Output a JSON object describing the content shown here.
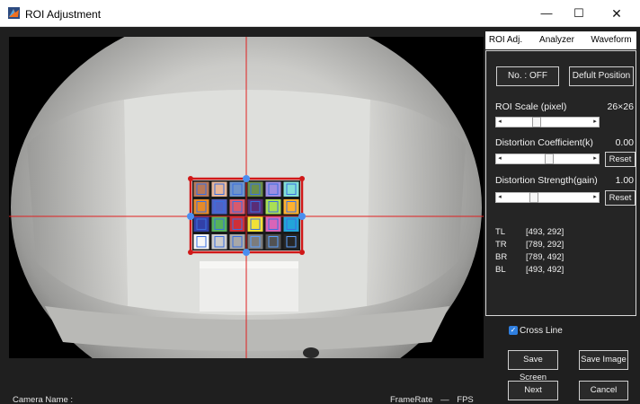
{
  "window": {
    "title": "ROI Adjustment",
    "minimize_glyph": "—",
    "maximize_glyph": "☐",
    "close_glyph": "✕"
  },
  "tabs": [
    {
      "label": "ROI Adj."
    },
    {
      "label": "Analyzer"
    },
    {
      "label": "Waveform"
    }
  ],
  "roi_panel": {
    "number_button": "No. : OFF",
    "default_position_button": "Defult Position",
    "roi_scale_label": "ROI Scale (pixel)",
    "roi_scale_value": "26×26",
    "distortion_coef_label": "Distortion Coefficient(k)",
    "distortion_coef_value": "0.00",
    "distortion_strength_label": "Distortion Strength(gain)",
    "distortion_strength_value": "1.00",
    "reset_label": "Reset",
    "sliders": {
      "roi_scale_fraction": 0.36,
      "distortion_coef_fraction": 0.52,
      "distortion_strength_fraction": 0.33
    },
    "corners": [
      {
        "name": "TL",
        "coords": "[493, 292]"
      },
      {
        "name": "TR",
        "coords": "[789, 292]"
      },
      {
        "name": "BR",
        "coords": "[789, 492]"
      },
      {
        "name": "BL",
        "coords": "[493, 492]"
      }
    ]
  },
  "controls": {
    "cross_line_label": "Cross Line",
    "cross_line_checked": true,
    "save_screen": "Save Screen",
    "save_image": "Save Image",
    "next": "Next",
    "cancel": "Cancel"
  },
  "status": {
    "camera_name_label": "Camera Name :",
    "framerate_label": "FrameRate",
    "framerate_value": "—",
    "fps_label": "FPS"
  },
  "colors": {
    "crosshair": "#e02020",
    "roi_box": "#d01818",
    "handle": "#4a8ef0",
    "checkbox": "#2f7fe0"
  },
  "icons": {
    "app": "matlab-icon",
    "slider_left": "arrow-left-icon",
    "slider_right": "arrow-right-icon"
  },
  "color_checker": [
    [
      "#b7785a",
      "#e8b79a",
      "#6f93c9",
      "#6b8f4c",
      "#9d8ee0",
      "#83e0d8"
    ],
    [
      "#e58a2a",
      "#4f63c7",
      "#d85a6e",
      "#5a2c77",
      "#a9df55",
      "#ffb12f"
    ],
    [
      "#3240a8",
      "#56b15c",
      "#cf2f38",
      "#f1e137",
      "#d964b8",
      "#22a5d9"
    ],
    [
      "#f7f7f7",
      "#cdcdcd",
      "#a8a8a8",
      "#7c7c7c",
      "#525252",
      "#262626"
    ]
  ]
}
